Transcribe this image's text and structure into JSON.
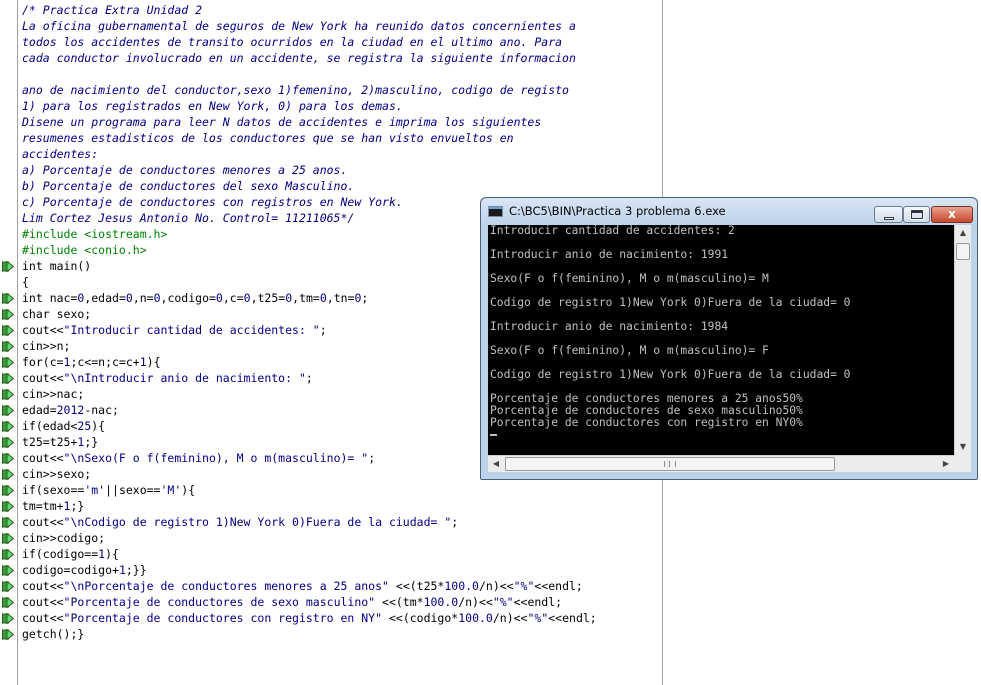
{
  "editor": {
    "lines": [
      [
        {
          "t": "/* Practica Extra Unidad 2",
          "k": "c"
        }
      ],
      [
        {
          "t": "La oficina gubernamental de seguros de New York ha reunido datos concernientes a",
          "k": "c"
        }
      ],
      [
        {
          "t": "todos los accidentes de transito ocurridos en la ciudad en el ultimo ano. Para",
          "k": "c"
        }
      ],
      [
        {
          "t": "cada conductor involucrado en un accidente, se registra la siguiente informacion",
          "k": "c"
        }
      ],
      [],
      [
        {
          "t": "ano de nacimiento del conductor,sexo 1)femenino, 2)masculino, codigo de registo",
          "k": "c"
        }
      ],
      [
        {
          "t": "1) para los registrados en New York, 0) para los demas.",
          "k": "c"
        }
      ],
      [
        {
          "t": "Disene un programa para leer N datos de accidentes e imprima los siguientes",
          "k": "c"
        }
      ],
      [
        {
          "t": "resumenes estadisticos de los conductores que se han visto envueltos en",
          "k": "c"
        }
      ],
      [
        {
          "t": "accidentes:",
          "k": "c"
        }
      ],
      [
        {
          "t": "a) Porcentaje de conductores menores a 25 anos.",
          "k": "c"
        }
      ],
      [
        {
          "t": "b) Porcentaje de conductores del sexo Masculino.",
          "k": "c"
        }
      ],
      [
        {
          "t": "c) Porcentaje de conductores con registros en New York.",
          "k": "c"
        }
      ],
      [
        {
          "t": "Lim Cortez Jesus Antonio No. Control= 11211065*/",
          "k": "c"
        }
      ],
      [
        {
          "t": "#include <iostream.h>",
          "k": "pp"
        }
      ],
      [
        {
          "t": "#include <conio.h>",
          "k": "pp"
        }
      ],
      [
        {
          "t": "int main()"
        }
      ],
      [
        {
          "t": "{"
        }
      ],
      [
        {
          "t": "int nac="
        },
        {
          "t": "0",
          "k": "nm"
        },
        {
          "t": ",edad="
        },
        {
          "t": "0",
          "k": "nm"
        },
        {
          "t": ",n="
        },
        {
          "t": "0",
          "k": "nm"
        },
        {
          "t": ",codigo="
        },
        {
          "t": "0",
          "k": "nm"
        },
        {
          "t": ",c="
        },
        {
          "t": "0",
          "k": "nm"
        },
        {
          "t": ",t25="
        },
        {
          "t": "0",
          "k": "nm"
        },
        {
          "t": ",tm="
        },
        {
          "t": "0",
          "k": "nm"
        },
        {
          "t": ",tn="
        },
        {
          "t": "0",
          "k": "nm"
        },
        {
          "t": ";"
        }
      ],
      [
        {
          "t": "char sexo;"
        }
      ],
      [
        {
          "t": "cout<<"
        },
        {
          "t": "\"Introducir cantidad de accidentes: \"",
          "k": "st"
        },
        {
          "t": ";"
        }
      ],
      [
        {
          "t": "cin>>n;"
        }
      ],
      [
        {
          "t": "for(c="
        },
        {
          "t": "1",
          "k": "nm"
        },
        {
          "t": ";c<=n;c=c+"
        },
        {
          "t": "1",
          "k": "nm"
        },
        {
          "t": "){"
        }
      ],
      [
        {
          "t": "cout<<"
        },
        {
          "t": "\"\\nIntroducir anio de nacimiento: \"",
          "k": "st"
        },
        {
          "t": ";"
        }
      ],
      [
        {
          "t": "cin>>nac;"
        }
      ],
      [
        {
          "t": "edad="
        },
        {
          "t": "2012",
          "k": "nm"
        },
        {
          "t": "-nac;"
        }
      ],
      [
        {
          "t": "if(edad<"
        },
        {
          "t": "25",
          "k": "nm"
        },
        {
          "t": "){"
        }
      ],
      [
        {
          "t": "t25=t25+"
        },
        {
          "t": "1",
          "k": "nm"
        },
        {
          "t": ";}"
        }
      ],
      [
        {
          "t": "cout<<"
        },
        {
          "t": "\"\\nSexo(F o f(feminino), M o m(masculino)= \"",
          "k": "st"
        },
        {
          "t": ";"
        }
      ],
      [
        {
          "t": "cin>>sexo;"
        }
      ],
      [
        {
          "t": "if(sexo=="
        },
        {
          "t": "'m'",
          "k": "st"
        },
        {
          "t": "||sexo=="
        },
        {
          "t": "'M'",
          "k": "st"
        },
        {
          "t": "){"
        }
      ],
      [
        {
          "t": "tm=tm+"
        },
        {
          "t": "1",
          "k": "nm"
        },
        {
          "t": ";}"
        }
      ],
      [
        {
          "t": "cout<<"
        },
        {
          "t": "\"\\nCodigo de registro 1)New York 0)Fuera de la ciudad= \"",
          "k": "st"
        },
        {
          "t": ";"
        }
      ],
      [
        {
          "t": "cin>>codigo;"
        }
      ],
      [
        {
          "t": "if(codigo=="
        },
        {
          "t": "1",
          "k": "nm"
        },
        {
          "t": "){"
        }
      ],
      [
        {
          "t": "codigo=codigo+"
        },
        {
          "t": "1",
          "k": "nm"
        },
        {
          "t": ";}}"
        }
      ],
      [
        {
          "t": "cout<<"
        },
        {
          "t": "\"\\nPorcentaje de conductores menores a 25 anos\"",
          "k": "st"
        },
        {
          "t": " <<(t25*"
        },
        {
          "t": "100.0",
          "k": "nm"
        },
        {
          "t": "/n)<<"
        },
        {
          "t": "\"%\"",
          "k": "st"
        },
        {
          "t": "<<endl;"
        }
      ],
      [
        {
          "t": "cout<<"
        },
        {
          "t": "\"Porcentaje de conductores de sexo masculino\"",
          "k": "st"
        },
        {
          "t": " <<(tm*"
        },
        {
          "t": "100.0",
          "k": "nm"
        },
        {
          "t": "/n)<<"
        },
        {
          "t": "\"%\"",
          "k": "st"
        },
        {
          "t": "<<endl;"
        }
      ],
      [
        {
          "t": "cout<<"
        },
        {
          "t": "\"Porcentaje de conductores con registro en NY\"",
          "k": "st"
        },
        {
          "t": " <<(codigo*"
        },
        {
          "t": "100.0",
          "k": "nm"
        },
        {
          "t": "/n)<<"
        },
        {
          "t": "\"%\"",
          "k": "st"
        },
        {
          "t": "<<endl;"
        }
      ],
      [
        {
          "t": "getch();}"
        }
      ]
    ],
    "breakpoint_icon": "green-arrow-step-icon",
    "breakpoint_lines": [
      16,
      18,
      19,
      20,
      21,
      22,
      23,
      24,
      25,
      26,
      27,
      28,
      29,
      30,
      31,
      32,
      33,
      34,
      35,
      36,
      37,
      38,
      39
    ]
  },
  "console": {
    "title": "C:\\BC5\\BIN\\Practica 3 problema 6.exe",
    "close_label": "x",
    "lines": [
      "Introducir cantidad de accidentes: 2",
      "",
      "Introducir anio de nacimiento: 1991",
      "",
      "Sexo(F o f(feminino), M o m(masculino)= M",
      "",
      "Codigo de registro 1)New York 0)Fuera de la ciudad= 0",
      "",
      "Introducir anio de nacimiento: 1984",
      "",
      "Sexo(F o f(feminino), M o m(masculino)= F",
      "",
      "Codigo de registro 1)New York 0)Fuera de la ciudad= 0",
      "",
      "Porcentaje de conductores menores a 25 anos50%",
      "Porcentaje de conductores de sexo masculino50%",
      "Porcentaje de conductores con registro en NY0%"
    ]
  }
}
